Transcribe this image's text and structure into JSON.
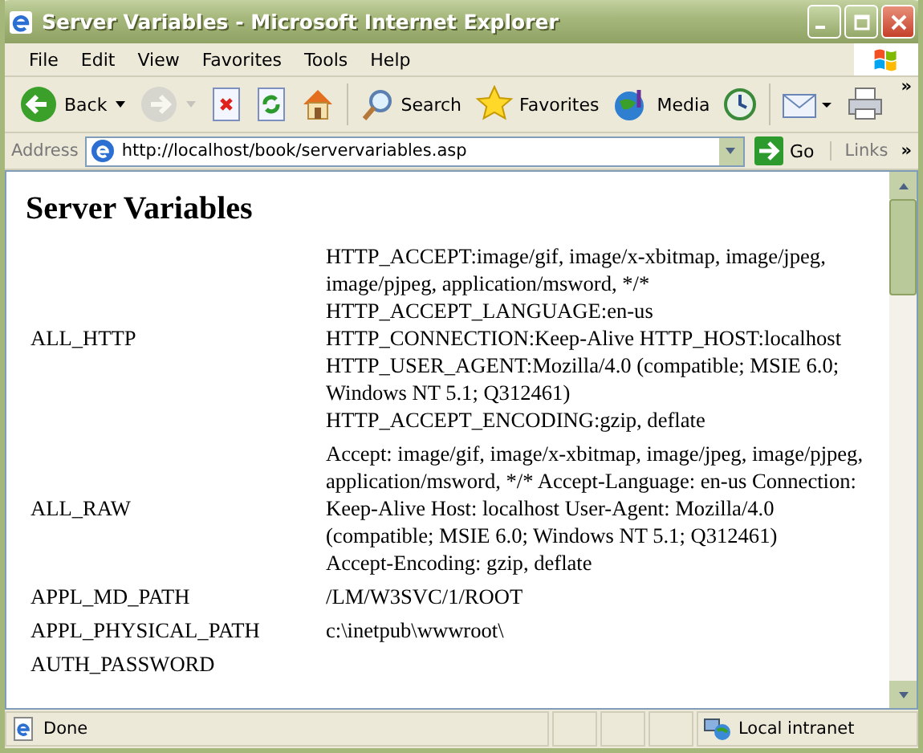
{
  "window": {
    "title": "Server Variables - Microsoft Internet Explorer"
  },
  "menu": [
    "File",
    "Edit",
    "View",
    "Favorites",
    "Tools",
    "Help"
  ],
  "toolbar": [
    {
      "kind": "back",
      "label": "Back",
      "disabled": false
    },
    {
      "kind": "forward",
      "disabled": true
    },
    {
      "kind": "stop",
      "disabled": false
    },
    {
      "kind": "refresh",
      "disabled": false
    },
    {
      "kind": "home",
      "disabled": false
    },
    {
      "kind": "search",
      "label": "Search",
      "disabled": false
    },
    {
      "kind": "favorites",
      "label": "Favorites",
      "disabled": false
    },
    {
      "kind": "media",
      "label": "Media",
      "disabled": false
    },
    {
      "kind": "history",
      "disabled": false
    },
    {
      "kind": "mail",
      "disabled": false
    },
    {
      "kind": "print",
      "disabled": false
    }
  ],
  "toolbar_more": "»",
  "address_bar": {
    "label": "Address",
    "value": "http://localhost/book/servervariables.asp",
    "go": "Go",
    "links": "Links",
    "more": "»"
  },
  "page": {
    "heading": "Server Variables",
    "rows": [
      {
        "name": "ALL_HTTP",
        "value": [
          "HTTP_ACCEPT:image/gif, image/x-xbitmap, image/jpeg, image/pjpeg, application/msword, */*",
          "HTTP_ACCEPT_LANGUAGE:en-us",
          "HTTP_CONNECTION:Keep-Alive HTTP_HOST:localhost",
          "HTTP_USER_AGENT:Mozilla/4.0 (compatible; MSIE 6.0; Windows NT 5.1; Q312461)",
          "HTTP_ACCEPT_ENCODING:gzip, deflate"
        ]
      },
      {
        "name": "ALL_RAW",
        "value": [
          "Accept: image/gif, image/x-xbitmap, image/jpeg, image/pjpeg, application/msword, */* Accept-Language: en-us Connection: Keep-Alive Host: localhost User-Agent: Mozilla/4.0 (compatible; MSIE 6.0; Windows NT 5.1; Q312461)",
          "Accept-Encoding: gzip, deflate"
        ]
      },
      {
        "name": "APPL_MD_PATH",
        "value": [
          "/LM/W3SVC/1/ROOT"
        ]
      },
      {
        "name": "APPL_PHYSICAL_PATH",
        "value": [
          "c:\\inetpub\\wwwroot\\"
        ]
      },
      {
        "name": "AUTH_PASSWORD"
      }
    ]
  },
  "status_bar": {
    "text": "Done",
    "zone": "Local intranet"
  }
}
